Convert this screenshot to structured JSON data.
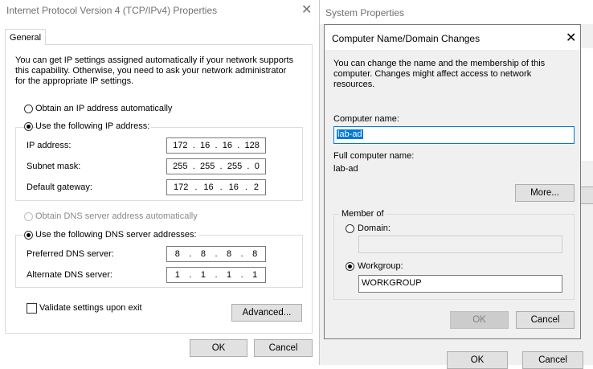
{
  "ipv4": {
    "title": "Internet Protocol Version 4 (TCP/IPv4) Properties",
    "tab": "General",
    "intro": "You can get IP settings assigned automatically if your network supports this capability. Otherwise, you need to ask your network administrator for the appropriate IP settings.",
    "obtain_ip_auto": "Obtain an IP address automatically",
    "use_following_ip": "Use the following IP address:",
    "ip_address_label": "IP address:",
    "ip_address": [
      "172",
      "16",
      "16",
      "128"
    ],
    "subnet_label": "Subnet mask:",
    "subnet": [
      "255",
      "255",
      "255",
      "0"
    ],
    "gateway_label": "Default gateway:",
    "gateway": [
      "172",
      "16",
      "16",
      "2"
    ],
    "obtain_dns_auto": "Obtain DNS server address automatically",
    "use_following_dns": "Use the following DNS server addresses:",
    "preferred_dns_label": "Preferred DNS server:",
    "preferred_dns": [
      "8",
      "8",
      "8",
      "8"
    ],
    "alternate_dns_label": "Alternate DNS server:",
    "alternate_dns": [
      "1",
      "1",
      "1",
      "1"
    ],
    "validate_label": "Validate settings upon exit",
    "validate_checked": false,
    "advanced_button": "Advanced...",
    "ok_button": "OK",
    "cancel_button": "Cancel"
  },
  "sysprops": {
    "title": "System Properties",
    "ok_button": "OK",
    "cancel_button": "Cancel"
  },
  "name_changes": {
    "title": "Computer Name/Domain Changes",
    "intro": "You can change the name and the membership of this computer. Changes might affect access to network resources.",
    "computer_name_label": "Computer name:",
    "computer_name_value": "lab-ad",
    "full_name_label": "Full computer name:",
    "full_name_value": "lab-ad",
    "more_button": "More...",
    "member_of_label": "Member of",
    "domain_label": "Domain:",
    "domain_value": "",
    "workgroup_label": "Workgroup:",
    "workgroup_value": "WORKGROUP",
    "ok_button": "OK",
    "cancel_button": "Cancel"
  },
  "colors": {
    "selection": "#0078d7",
    "button_face": "#e1e1e1",
    "disabled_text": "#838383"
  },
  "icons": [
    "close-icon"
  ]
}
